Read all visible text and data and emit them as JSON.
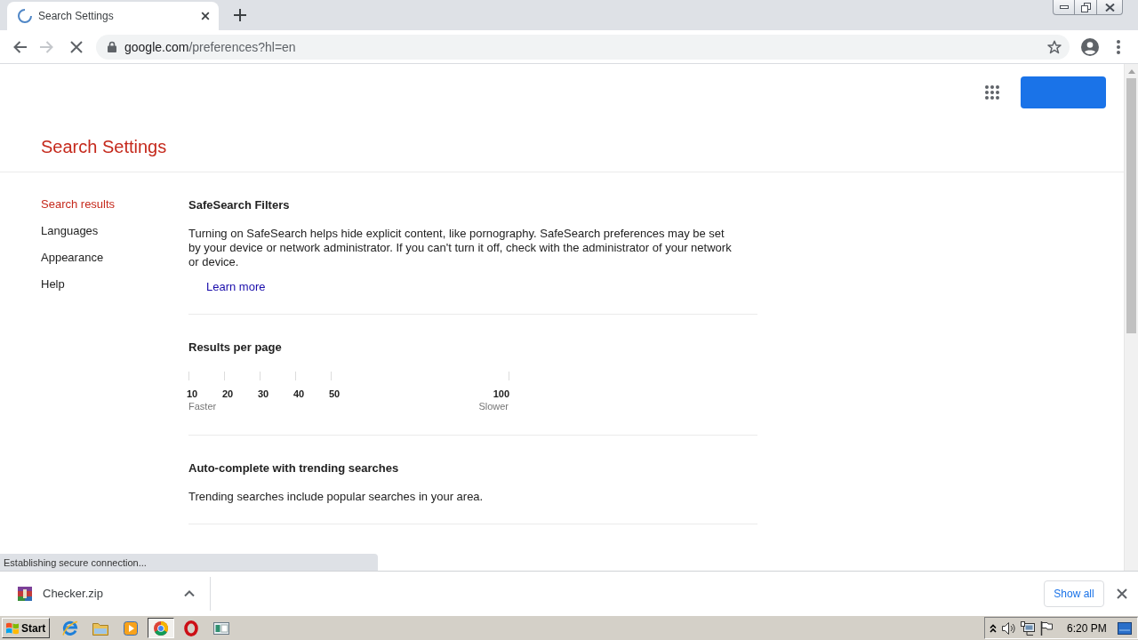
{
  "browser": {
    "tabs": [
      {
        "title": "Search Settings",
        "selected": true,
        "loading": true
      }
    ],
    "toolbar": {
      "forward_disabled": true,
      "loading": true
    },
    "address_bar": {
      "domain": "google.com",
      "path": "/preferences?hl=en"
    },
    "status_bubble": "Establishing secure connection..."
  },
  "page": {
    "title": "Search Settings",
    "nav": [
      {
        "label": "Search results",
        "selected": true
      },
      {
        "label": "Languages",
        "selected": false
      },
      {
        "label": "Appearance",
        "selected": false
      },
      {
        "label": "Help",
        "selected": false
      }
    ],
    "sections": [
      {
        "kind": "text",
        "heading": "SafeSearch Filters",
        "body": "Turning on SafeSearch helps hide explicit content, like pornography. SafeSearch preferences may be set by your device or network administrator. If you can't turn it off, check with the administrator of your network or device.",
        "link": "Learn more"
      },
      {
        "kind": "scale",
        "heading": "Results per page",
        "ticks": [
          "10",
          "20",
          "30",
          "40",
          "50",
          "100"
        ],
        "low_caption": "Faster",
        "high_caption": "Slower"
      },
      {
        "kind": "text",
        "heading": "Auto-complete with trending searches",
        "body": "Trending searches include popular searches in your area."
      }
    ]
  },
  "downloads": {
    "items": [
      {
        "filename": "Checker.zip"
      }
    ],
    "show_all": "Show all"
  },
  "taskbar": {
    "start": "Start",
    "buttons": [
      {
        "selected": false
      },
      {
        "selected": false
      },
      {
        "selected": false
      },
      {
        "selected": true
      },
      {
        "selected": false
      },
      {
        "selected": false
      }
    ],
    "clock": "6:20 PM"
  }
}
